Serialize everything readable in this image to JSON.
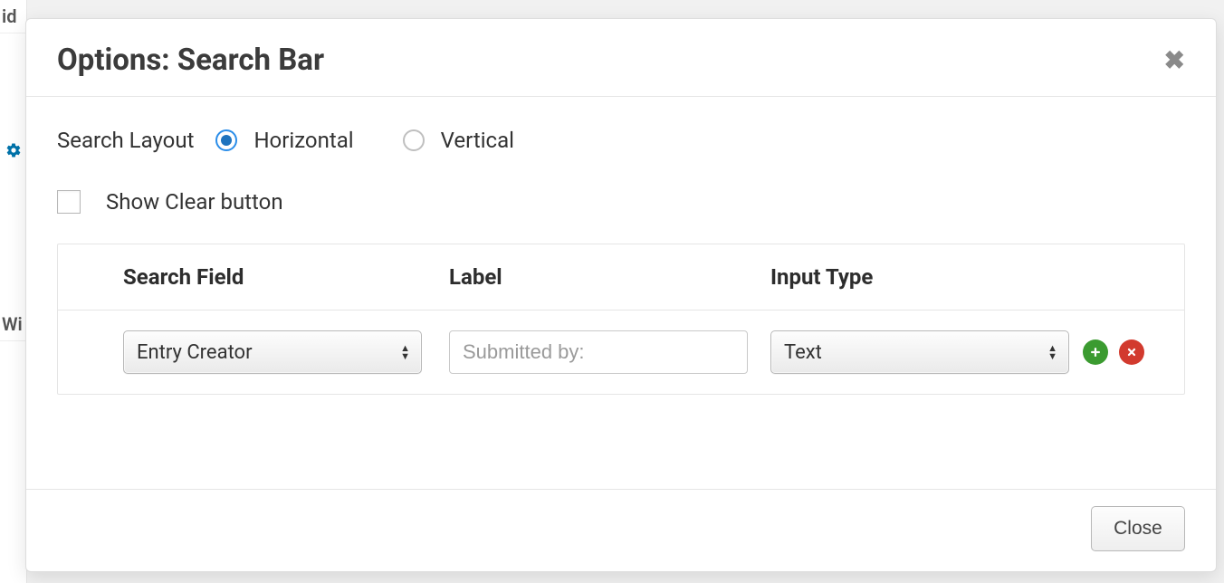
{
  "background": {
    "fragment_top": "id",
    "fragment_mid": "Wi",
    "gear_icon": "gear-icon"
  },
  "modal": {
    "title": "Options: Search Bar",
    "layout": {
      "label": "Search Layout",
      "options": [
        {
          "label": "Horizontal",
          "selected": true
        },
        {
          "label": "Vertical",
          "selected": false
        }
      ]
    },
    "show_clear": {
      "label": "Show Clear button",
      "checked": false
    },
    "table": {
      "headers": {
        "field": "Search Field",
        "label": "Label",
        "type": "Input Type"
      },
      "rows": [
        {
          "field_value": "Entry Creator",
          "label_placeholder": "Submitted by:",
          "label_value": "",
          "type_value": "Text"
        }
      ]
    },
    "actions": {
      "add": "+",
      "remove": "✕"
    },
    "footer": {
      "close": "Close"
    }
  }
}
